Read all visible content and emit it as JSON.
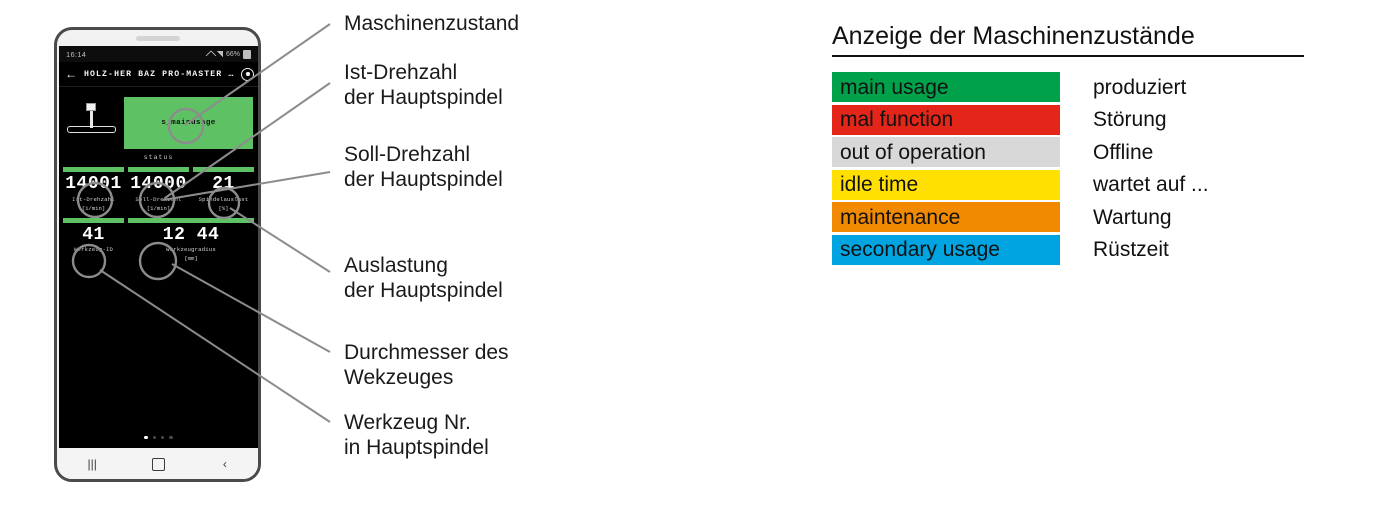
{
  "phone": {
    "statusbar": {
      "time": "16:14",
      "battery": "66%"
    },
    "appbar": {
      "back_icon": "arrow-left-icon",
      "title": "HOLZ-HER BAZ PRO-MASTER …",
      "action_icon": "record-icon"
    },
    "status_panel": {
      "value": "s_mainusage",
      "caption": "status",
      "color": "#5ec264"
    },
    "tool_icon_name": "spindle-tool-icon",
    "tiles": [
      {
        "value": "14001",
        "label": "Ist-Drehzahl",
        "unit": "[1/min]"
      },
      {
        "value": "14000",
        "label": "Soll-Drehzahl",
        "unit": "[1/min]"
      },
      {
        "value": "21",
        "label": "Spindelauslast",
        "unit": "[%]"
      },
      {
        "value": "41",
        "label": "Werkzeug-ID",
        "unit": ""
      },
      {
        "value": "12 44",
        "label": "Werkzeugradius",
        "unit": "[mm]"
      }
    ],
    "page_dots": {
      "count": 4,
      "active": 1
    },
    "navbar": {
      "recents": "|||",
      "home": "home-square-icon",
      "back": "‹"
    }
  },
  "callouts": [
    {
      "text": "Maschinenzustand"
    },
    {
      "text": "Ist-Drehzahl\nder Hauptspindel"
    },
    {
      "text": "Soll-Drehzahl\nder Hauptspindel"
    },
    {
      "text": "Auslastung\nder Hauptspindel"
    },
    {
      "text": "Durchmesser des\nWekzeuges"
    },
    {
      "text": "Werkzeug Nr.\nin Hauptspindel"
    }
  ],
  "legend": {
    "title": "Anzeige der Maschinenzustände",
    "rows": [
      {
        "en": "main usage",
        "de": "produziert",
        "color": "#00a14b"
      },
      {
        "en": "mal function",
        "de": "Störung",
        "color": "#e32619"
      },
      {
        "en": "out of operation",
        "de": "Offline",
        "color": "#d8d8d8"
      },
      {
        "en": "idle time",
        "de": "wartet auf ...",
        "color": "#ffe000"
      },
      {
        "en": "maintenance",
        "de": "Wartung",
        "color": "#f18a00"
      },
      {
        "en": "secondary usage",
        "de": "Rüstzeit",
        "color": "#00a4e0"
      }
    ]
  }
}
